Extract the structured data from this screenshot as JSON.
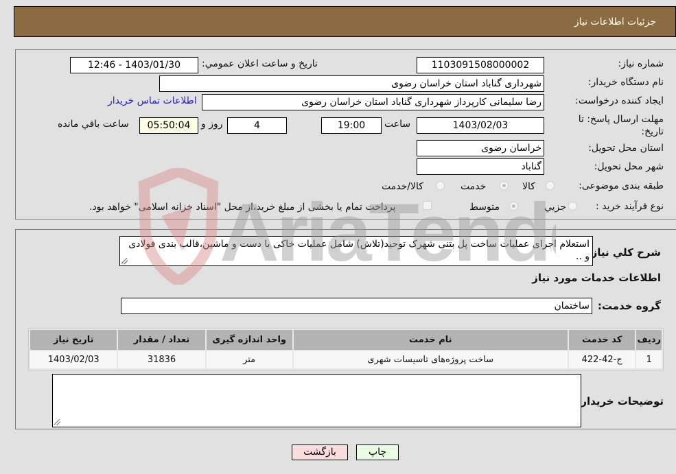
{
  "header": {
    "title": "جزئیات اطلاعات نیاز"
  },
  "fields": {
    "need_number": {
      "label": "شماره نیاز:",
      "value": "1103091508000002"
    },
    "announce_datetime": {
      "label": "تاریخ و ساعت اعلان عمومي:",
      "value": "1403/01/30 - 12:46"
    },
    "buyer_org": {
      "label": "نام دستگاه خریدار:",
      "value": "شهرداری گناباد استان خراسان رضوی"
    },
    "requester": {
      "label": "ایجاد کننده درخواست:",
      "value": "رضا سلیمانی کارپرداز شهرداری گناباد استان خراسان رضوی"
    },
    "contact_link": "اطلاعات تماس خریدار",
    "deadline": {
      "label": "مهلت ارسال پاسخ: تا تاریخ:",
      "date": "1403/02/03",
      "time_label": "ساعت",
      "time": "19:00",
      "days": "4",
      "days_label": "روز و",
      "remaining": "05:50:04",
      "remaining_label": "ساعت باقي مانده"
    },
    "delivery_province": {
      "label": "استان محل تحویل:",
      "value": "خراسان رضوی"
    },
    "delivery_city": {
      "label": "شهر محل تحویل:",
      "value": "گناباد"
    },
    "category": {
      "label": "طبقه بندی موضوعی:",
      "options": [
        "کالا",
        "خدمت",
        "کالا/خدمت"
      ],
      "selected": "خدمت"
    },
    "purchase_process": {
      "label": "نوع فرآیند خرید :",
      "options": [
        "جزيي",
        "متوسط"
      ],
      "selected": "متوسط",
      "treasury_checkbox_label": "پرداخت تمام یا بخشی از مبلغ خرید،از محل \"اسناد خزانه اسلامی\" خواهد بود.",
      "treasury_checked": false
    }
  },
  "description": {
    "label": "شرح کلي نیاز:",
    "value": "استعلام اجرای عملیات ساخت پل بتنی شهرک توحید(تلاش) شامل عملیات خاکی با دست و ماشین،قالب بندی فولادی و .."
  },
  "services": {
    "section_title": "اطلاعات خدمات مورد نیاز",
    "group_label": "گروه خدمت:",
    "group_value": "ساختمان",
    "columns": [
      "ردیف",
      "کد خدمت",
      "نام خدمت",
      "واحد اندازه گیری",
      "تعداد / مقدار",
      "تاریخ نیاز"
    ],
    "rows": [
      [
        "1",
        "ج-42-422",
        "ساخت پروژه‌های تاسیسات شهری",
        "متر",
        "31836",
        "1403/02/03"
      ]
    ]
  },
  "buyer_notes": {
    "label": "توضیحات خریدار:",
    "value": ""
  },
  "buttons": {
    "back": "بازگشت",
    "print": "چاپ"
  },
  "watermark": "AriaTender.neT"
}
